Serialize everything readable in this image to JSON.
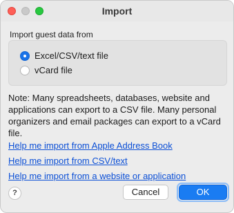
{
  "window": {
    "title": "Import"
  },
  "group": {
    "label": "Import guest data from",
    "options": [
      {
        "label": "Excel/CSV/text file",
        "selected": true
      },
      {
        "label": "vCard file",
        "selected": false
      }
    ]
  },
  "note": "Note: Many spreadsheets, databases, website and applications can export to a CSV file. Many personal organizers and email packages can export to a vCard file.",
  "links": [
    "Help me import from Apple Address Book",
    "Help me import from CSV/text",
    "Help me import from a website or application"
  ],
  "footer": {
    "help_label": "?",
    "cancel_label": "Cancel",
    "ok_label": "OK"
  },
  "colors": {
    "accent": "#1a7cf2",
    "link": "#0b4fd6",
    "close": "#fe5f57",
    "maximize": "#28c840"
  }
}
